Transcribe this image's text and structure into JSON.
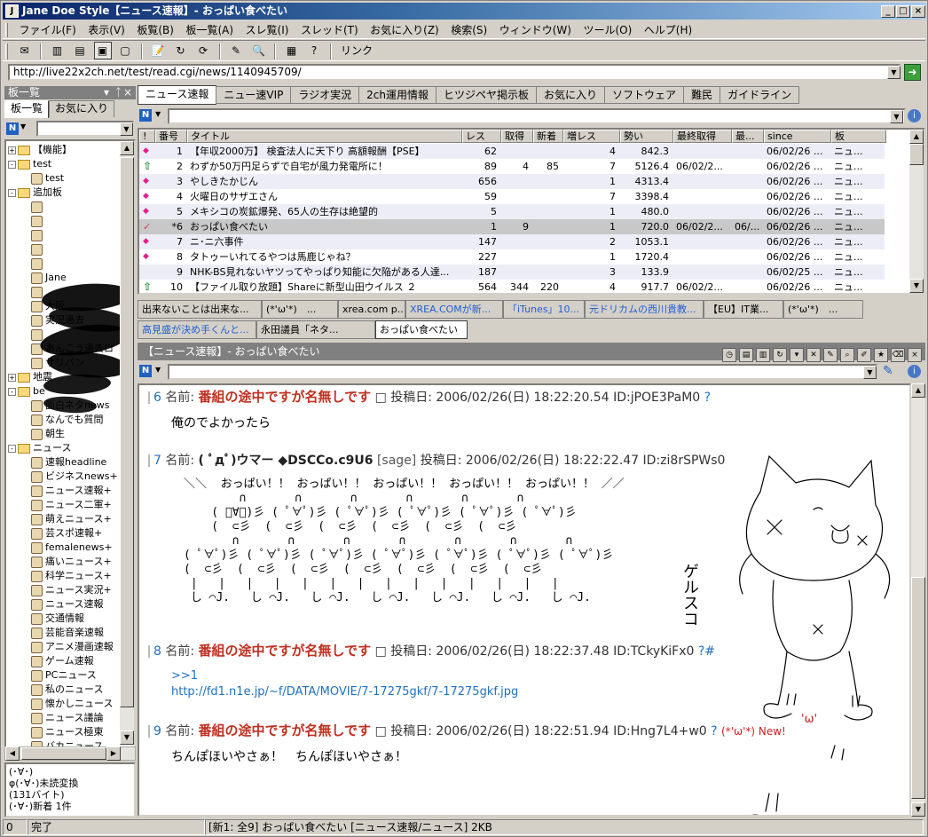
{
  "window": {
    "title": "Jane Doe Style【ニュース速報】- おっぱい食べたい",
    "app_icon": "J"
  },
  "menu": [
    "ファイル(F)",
    "表示(V)",
    "板覧(B)",
    "板一覧(A)",
    "スレ覧(I)",
    "スレッド(T)",
    "お気に入り(Z)",
    "検索(S)",
    "ウィンドウ(W)",
    "ツール(O)",
    "ヘルプ(H)"
  ],
  "toolbar": {
    "link_label": "リンク"
  },
  "address": {
    "url": "http://live22x2ch.net/test/read.cgi/news/1140945709/"
  },
  "left_panel": {
    "title": "板一覧",
    "tabs": [
      "板一覧",
      "お気に入り"
    ],
    "tree": [
      {
        "label": "【機能】",
        "type": "folder",
        "level": 0,
        "sign": "+"
      },
      {
        "label": "test",
        "type": "folder",
        "level": 0,
        "sign": "-"
      },
      {
        "label": "test",
        "type": "board",
        "level": 1
      },
      {
        "label": "追加板",
        "type": "folder",
        "level": 0,
        "sign": "-"
      },
      {
        "label": "",
        "type": "board",
        "level": 1
      },
      {
        "label": "",
        "type": "board",
        "level": 1
      },
      {
        "label": "",
        "type": "board",
        "level": 1
      },
      {
        "label": "",
        "type": "board",
        "level": 1
      },
      {
        "label": "",
        "type": "board",
        "level": 1
      },
      {
        "label": "Jane",
        "type": "board",
        "level": 1
      },
      {
        "label": "",
        "type": "board",
        "level": 1
      },
      {
        "label": "大阪",
        "type": "board",
        "level": 1
      },
      {
        "label": "実況過去",
        "type": "board",
        "level": 1
      },
      {
        "label": "",
        "type": "board",
        "level": 1
      },
      {
        "label": "あんこう過去ロ",
        "type": "board",
        "level": 1
      },
      {
        "label": "サリバン",
        "type": "board",
        "level": 1
      },
      {
        "label": "地震",
        "type": "folder",
        "level": 0,
        "sign": "+"
      },
      {
        "label": "be",
        "type": "folder",
        "level": 0,
        "sign": "-"
      },
      {
        "label": "面白ネタnews",
        "type": "board",
        "level": 1
      },
      {
        "label": "なんでも質問",
        "type": "board",
        "level": 1
      },
      {
        "label": "朝生",
        "type": "board",
        "level": 1
      },
      {
        "label": "ニュース",
        "type": "folder",
        "level": 0,
        "sign": "-"
      },
      {
        "label": "速報headline",
        "type": "board",
        "level": 1
      },
      {
        "label": "ビジネスnews+",
        "type": "board",
        "level": 1
      },
      {
        "label": "ニュース速報+",
        "type": "board",
        "level": 1
      },
      {
        "label": "ニュース二軍+",
        "type": "board",
        "level": 1
      },
      {
        "label": "萌えニュース+",
        "type": "board",
        "level": 1
      },
      {
        "label": "芸スポ速報+",
        "type": "board",
        "level": 1
      },
      {
        "label": "femalenews+",
        "type": "board",
        "level": 1
      },
      {
        "label": "痛いニュース+",
        "type": "board",
        "level": 1
      },
      {
        "label": "科学ニュース+",
        "type": "board",
        "level": 1
      },
      {
        "label": "ニュース実況+",
        "type": "board",
        "level": 1
      },
      {
        "label": "ニュース速報",
        "type": "board",
        "level": 1
      },
      {
        "label": "交通情報",
        "type": "board",
        "level": 1
      },
      {
        "label": "芸能音楽速報",
        "type": "board",
        "level": 1
      },
      {
        "label": "アニメ漫画速報",
        "type": "board",
        "level": 1
      },
      {
        "label": "ゲーム速報",
        "type": "board",
        "level": 1
      },
      {
        "label": "PCニュース",
        "type": "board",
        "level": 1
      },
      {
        "label": "私のニュース",
        "type": "board",
        "level": 1
      },
      {
        "label": "懐かしニュース",
        "type": "board",
        "level": 1
      },
      {
        "label": "ニュース議論",
        "type": "board",
        "level": 1
      },
      {
        "label": "ニュース極東",
        "type": "board",
        "level": 1
      },
      {
        "label": "バカニュース",
        "type": "board",
        "level": 1
      }
    ],
    "log": [
      "(･∀･)",
      "φ(･∀･)未読変換",
      "(131バイト)",
      "(･∀･)新着 1件"
    ]
  },
  "board_tabs": [
    "ニュース速報",
    "ニュー速VIP",
    "ラジオ実況",
    "2ch運用情報",
    "ヒツジペヤ掲示板",
    "お気に入り",
    "ソフトウェア",
    "難民",
    "ガイドライン"
  ],
  "thread_list": {
    "headers": [
      "!",
      "番号",
      "タイトル",
      "レス",
      "取得",
      "新着",
      "増レス",
      "勢い",
      "最終取得",
      "最...",
      "since",
      "板"
    ],
    "rows": [
      {
        "mark": "dot",
        "num": "1",
        "title": "【年収2000万】 検査法人に天下り 高額報酬【PSE】",
        "res": "62",
        "got": "",
        "new": "",
        "inc": "4",
        "mom": "842.3",
        "last": "",
        "last2": "",
        "since": "06/02/26 ...",
        "board": "ニュ..."
      },
      {
        "mark": "arrow",
        "num": "2",
        "title": "わずか50万円足らずで自宅が風力発電所に！",
        "res": "89",
        "got": "4",
        "new": "85",
        "inc": "7",
        "mom": "5126.4",
        "last": "06/02/2...",
        "last2": "",
        "since": "06/02/26 ...",
        "board": "ニュ..."
      },
      {
        "mark": "dot",
        "num": "3",
        "title": "やしきたかじん",
        "res": "656",
        "got": "",
        "new": "",
        "inc": "1",
        "mom": "4313.4",
        "last": "",
        "last2": "",
        "since": "06/02/26 ...",
        "board": "ニュ..."
      },
      {
        "mark": "dot",
        "num": "4",
        "title": "火曜日のサザエさん",
        "res": "59",
        "got": "",
        "new": "",
        "inc": "7",
        "mom": "3398.4",
        "last": "",
        "last2": "",
        "since": "06/02/26 ...",
        "board": "ニュ..."
      },
      {
        "mark": "dot",
        "num": "5",
        "title": "メキシコの炭鉱爆発、65人の生存は絶望的",
        "res": "5",
        "got": "",
        "new": "",
        "inc": "1",
        "mom": "480.0",
        "last": "",
        "last2": "",
        "since": "06/02/26 ...",
        "board": "ニュ..."
      },
      {
        "mark": "check",
        "num": "*6",
        "title": "おっぱい食べたい",
        "res": "1",
        "got": "9",
        "new": "",
        "inc": "1",
        "mom": "720.0",
        "last": "06/02/2...",
        "last2": "06/...",
        "since": "06/02/26 ...",
        "board": "ニュ..."
      },
      {
        "mark": "dot",
        "num": "7",
        "title": "ニ･ニ六事件",
        "res": "147",
        "got": "",
        "new": "",
        "inc": "2",
        "mom": "1053.1",
        "last": "",
        "last2": "",
        "since": "06/02/26 ...",
        "board": "ニュ..."
      },
      {
        "mark": "dot",
        "num": "8",
        "title": "タトゥーいれてるやつは馬鹿じゃね？",
        "res": "227",
        "got": "",
        "new": "",
        "inc": "1",
        "mom": "1720.4",
        "last": "",
        "last2": "",
        "since": "06/02/26 ...",
        "board": "ニュ..."
      },
      {
        "mark": "",
        "num": "9",
        "title": "NHK-BS見れないヤツってやっぱり知能に欠陥がある人達...",
        "res": "187",
        "got": "",
        "new": "",
        "inc": "3",
        "mom": "133.9",
        "last": "",
        "last2": "",
        "since": "06/02/25 ...",
        "board": "ニュ..."
      },
      {
        "mark": "arrow",
        "num": "10",
        "title": "【ファイル取り放題】Shareに新型山田ウイルス ２",
        "res": "564",
        "got": "344",
        "new": "220",
        "inc": "4",
        "mom": "917.7",
        "last": "06/02/2...",
        "last2": "",
        "since": "06/02/26 ...",
        "board": "ニュ..."
      }
    ]
  },
  "thread_tabs": [
    {
      "label": "出来ないことは出来な...",
      "blue": false
    },
    {
      "label": "(*'ω'*)　...",
      "blue": false
    },
    {
      "label": "xrea.com p...",
      "blue": false
    },
    {
      "label": "XREA.COMが新...",
      "blue": true
    },
    {
      "label": "「iTunes」10...",
      "blue": true
    },
    {
      "label": "元ドリカムの西川貴教...",
      "blue": true
    },
    {
      "label": "【EU】IT業...",
      "blue": false
    },
    {
      "label": "(*'ω'*)　...",
      "blue": false
    },
    {
      "label": "高見盛が決め手くんと...",
      "blue": true
    },
    {
      "label": "永田議員「ネタ...",
      "blue": false
    },
    {
      "label": "おっぱい食べたい",
      "blue": false
    }
  ],
  "thread_title": "【ニュース速報】- おっぱい食べたい",
  "posts": [
    {
      "num": "6",
      "name_label": "名前:",
      "name": "番組の途中ですが名無しです",
      "date": "□ 投稿日: 2006/02/26(日) 18:22:20.54",
      "id": "ID:jPOE3PaM0",
      "q": "?",
      "body": "俺のでよかったら"
    },
    {
      "num": "7",
      "name_label": "名前:",
      "name": "( ﾟдﾟ)ウマー ◆DSCCo.c9U6",
      "mail": "[sage]",
      "date": "投稿日: 2006/02/26(日) 18:22:22.47",
      "id": "ID:zi8rSPWs0",
      "aa": "＼＼  おっぱい！！ おっぱい！！ おっぱい！！ おっぱい！！ おっぱい！！ ／／\n        ∩       ∩       ∩       ∩       ∩       ∩\n    ( ﾟ∀ﾟ)彡 ( ﾟ∀ﾟ)彡 ( ﾟ∀ﾟ)彡 ( ﾟ∀ﾟ)彡 ( ﾟ∀ﾟ)彡 ( ﾟ∀ﾟ)彡\n    (  ⊂彡  (  ⊂彡  (  ⊂彡  (  ⊂彡  (  ⊂彡  (  ⊂彡\n       ∩       ∩       ∩       ∩       ∩       ∩       ∩\n( ﾟ∀ﾟ)彡 ( ﾟ∀ﾟ)彡 ( ﾟ∀ﾟ)彡 ( ﾟ∀ﾟ)彡 ( ﾟ∀ﾟ)彡 ( ﾟ∀ﾟ)彡 ( ﾟ∀ﾟ)彡\n(  ⊂彡  (  ⊂彡  (  ⊂彡  (  ⊂彡  (  ⊂彡  (  ⊂彡  (  ⊂彡\n |   |   |   |   |   |   |   |   |   |   |   |   |   |\n し ⌒J.   し ⌒J.   し ⌒J.   し ⌒J.   し ⌒J.   し ⌒J.   し ⌒J."
    },
    {
      "num": "8",
      "name_label": "名前:",
      "name": "番組の途中ですが名無しです",
      "date": "□ 投稿日: 2006/02/26(日) 18:22:37.48",
      "id": "ID:TCkyKiFx0",
      "q": "?#",
      "body_link1": ">>1",
      "body_link2": "http://fd1.n1e.jp/~f/DATA/MOVIE/7-17275gkf/7-17275gkf.jpg"
    },
    {
      "num": "9",
      "name_label": "名前:",
      "name": "番組の途中ですが名無しです",
      "date": "□ 投稿日: 2006/02/26(日) 18:22:51.94",
      "id": "ID:Hng7L4+w0",
      "q": "?",
      "newmark": "(*'ω'*) New!",
      "body": "ちんぽほいやさぁ！　ちんぽほいやさぁ！"
    }
  ],
  "doodle_text": "ゲルスコ",
  "status": {
    "count": "0",
    "state": "完了",
    "info": "[新1: 全9] おっぱい食べたい [ニュース速報/ニュース] 2KB"
  }
}
